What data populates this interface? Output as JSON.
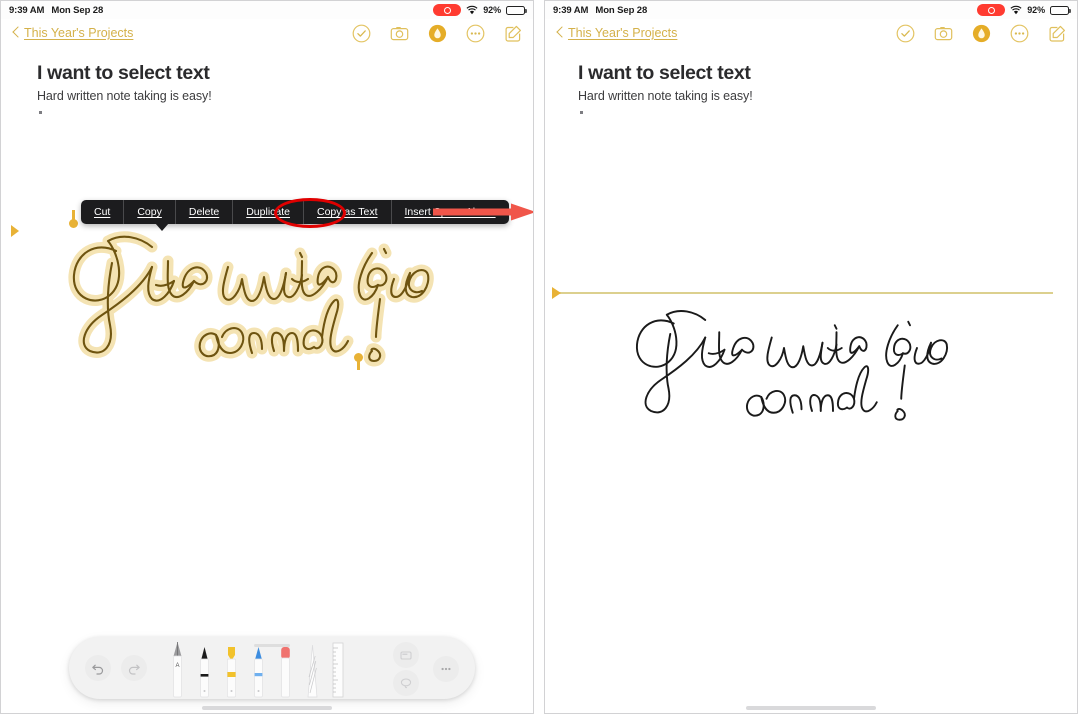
{
  "meta": {
    "app": "Notability",
    "layout": "two-panel-comparison",
    "colors": {
      "accent_gold": "#d4b14a",
      "selection_gold": "#e8b236",
      "menu_background": "#1c1c1e",
      "annotation_red": "#e00000",
      "arrow_red": "#f0564a",
      "ink_black": "#1a1a1a",
      "ink_selected": "#8a6a12"
    }
  },
  "status_bar": {
    "time": "9:39 AM",
    "date": "Mon Sep 28",
    "recording_indicator": "screen-recording-pill",
    "wifi_icon": "wifi-icon",
    "battery_percent": "92%",
    "battery_level": 92
  },
  "nav_bar": {
    "back_label": "This Year's Projects",
    "back_chevron": "chevron-left-icon",
    "icons": [
      {
        "name": "checkmark-circle-icon",
        "label": "Done"
      },
      {
        "name": "camera-icon",
        "label": "Camera"
      },
      {
        "name": "annotation-circle-icon",
        "label": "Annotate",
        "active": true
      },
      {
        "name": "ellipsis-circle-icon",
        "label": "More"
      },
      {
        "name": "compose-icon",
        "label": "New Note"
      }
    ]
  },
  "document": {
    "title": "I want to select text",
    "subtitle": "Hard written note taking is easy!",
    "handwriting_line_1": "Just write like",
    "handwriting_line_2": "normal !"
  },
  "context_menu": {
    "items": [
      {
        "label": "Cut",
        "name": "menu-item-cut"
      },
      {
        "label": "Copy",
        "name": "menu-item-copy"
      },
      {
        "label": "Delete",
        "name": "menu-item-delete"
      },
      {
        "label": "Duplicate",
        "name": "menu-item-duplicate"
      },
      {
        "label": "Copy as Text",
        "name": "menu-item-copy-as-text",
        "highlighted": true
      },
      {
        "label": "Insert Space Above",
        "name": "menu-item-insert-space-above"
      }
    ]
  },
  "annotations": {
    "circle_target": "Copy as Text",
    "arrow_direction": "right"
  },
  "tool_palette": {
    "undo_label": "Undo",
    "redo_label": "Redo",
    "tools": [
      {
        "name": "scribble-pen-tool",
        "label": "A",
        "color": "#bfbfbf"
      },
      {
        "name": "black-pen-tool",
        "label": "",
        "color": "#1a1a1a"
      },
      {
        "name": "yellow-highlighter-tool",
        "label": "",
        "color": "#f2c22c"
      },
      {
        "name": "blue-pen-tool",
        "label": "",
        "color": "#4c9ae8"
      },
      {
        "name": "red-eraser-tool",
        "label": "",
        "color": "#f0736f"
      },
      {
        "name": "shader-tool",
        "label": "",
        "color": "#c8c8c8"
      },
      {
        "name": "ruler-tool",
        "label": "",
        "color": "#bdbdbd"
      }
    ],
    "right_buttons": [
      {
        "name": "sticky-note-button",
        "label": ""
      },
      {
        "name": "lasso-select-button",
        "label": ""
      },
      {
        "name": "more-options-button",
        "label": ""
      }
    ]
  },
  "panels": [
    {
      "id": "left",
      "state": "handwriting-selected-with-menu"
    },
    {
      "id": "right",
      "state": "handwriting-deselected-insertion-line"
    }
  ]
}
